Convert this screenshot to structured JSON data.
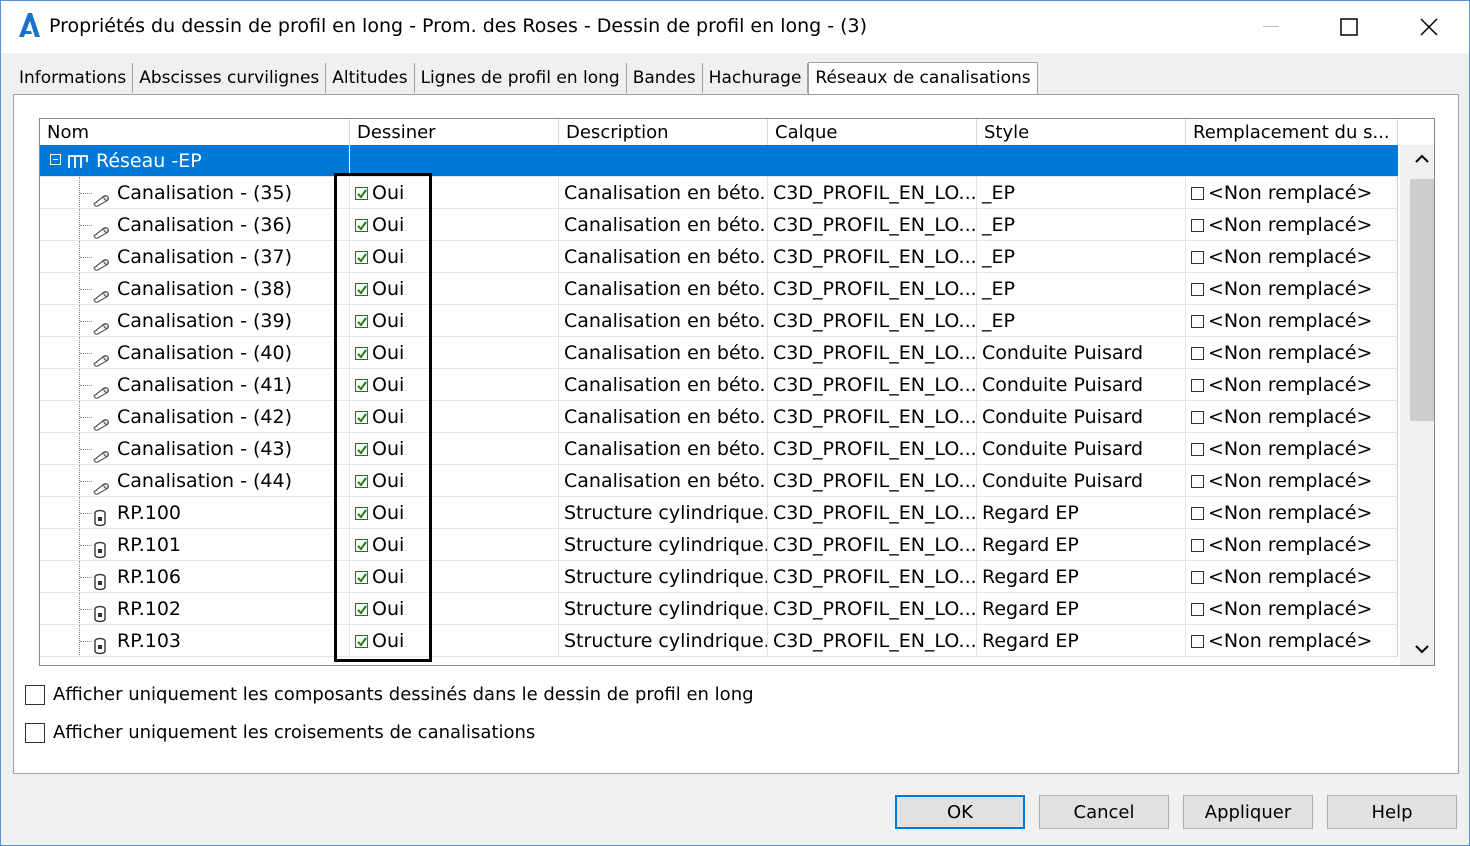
{
  "window": {
    "title": "Propriétés du dessin de profil en long - Prom. des Roses - Dessin de profil en long - (3)"
  },
  "tabs": [
    {
      "label": "Informations"
    },
    {
      "label": "Abscisses curvilignes"
    },
    {
      "label": "Altitudes"
    },
    {
      "label": "Lignes de profil en long"
    },
    {
      "label": "Bandes"
    },
    {
      "label": "Hachurage"
    },
    {
      "label": "Réseaux de canalisations",
      "active": true
    }
  ],
  "grid": {
    "columns": [
      "Nom",
      "Dessiner",
      "Description",
      "Calque",
      "Style",
      "Remplacement du s..."
    ],
    "network": {
      "label": "Réseau -EP"
    },
    "rows": [
      {
        "nom": "Canalisation - (35)",
        "icon": "pipe-icon",
        "dessiner": "Oui",
        "description": "Canalisation en béto...",
        "calque": "C3D_PROFIL_EN_LO...",
        "style": "_EP",
        "remplacement": "<Non remplacé>"
      },
      {
        "nom": "Canalisation - (36)",
        "icon": "pipe-icon",
        "dessiner": "Oui",
        "description": "Canalisation en béto...",
        "calque": "C3D_PROFIL_EN_LO...",
        "style": "_EP",
        "remplacement": "<Non remplacé>"
      },
      {
        "nom": "Canalisation - (37)",
        "icon": "pipe-icon",
        "dessiner": "Oui",
        "description": "Canalisation en béto...",
        "calque": "C3D_PROFIL_EN_LO...",
        "style": "_EP",
        "remplacement": "<Non remplacé>"
      },
      {
        "nom": "Canalisation - (38)",
        "icon": "pipe-icon",
        "dessiner": "Oui",
        "description": "Canalisation en béto...",
        "calque": "C3D_PROFIL_EN_LO...",
        "style": "_EP",
        "remplacement": "<Non remplacé>"
      },
      {
        "nom": "Canalisation - (39)",
        "icon": "pipe-icon",
        "dessiner": "Oui",
        "description": "Canalisation en béto...",
        "calque": "C3D_PROFIL_EN_LO...",
        "style": "_EP",
        "remplacement": "<Non remplacé>"
      },
      {
        "nom": "Canalisation - (40)",
        "icon": "pipe-icon",
        "dessiner": "Oui",
        "description": "Canalisation en béto...",
        "calque": "C3D_PROFIL_EN_LO...",
        "style": "Conduite Puisard",
        "remplacement": "<Non remplacé>"
      },
      {
        "nom": "Canalisation - (41)",
        "icon": "pipe-icon",
        "dessiner": "Oui",
        "description": "Canalisation en béto...",
        "calque": "C3D_PROFIL_EN_LO...",
        "style": "Conduite Puisard",
        "remplacement": "<Non remplacé>"
      },
      {
        "nom": "Canalisation - (42)",
        "icon": "pipe-icon",
        "dessiner": "Oui",
        "description": "Canalisation en béto...",
        "calque": "C3D_PROFIL_EN_LO...",
        "style": "Conduite Puisard",
        "remplacement": "<Non remplacé>"
      },
      {
        "nom": "Canalisation - (43)",
        "icon": "pipe-icon",
        "dessiner": "Oui",
        "description": "Canalisation en béto...",
        "calque": "C3D_PROFIL_EN_LO...",
        "style": "Conduite Puisard",
        "remplacement": "<Non remplacé>"
      },
      {
        "nom": "Canalisation - (44)",
        "icon": "pipe-icon",
        "dessiner": "Oui",
        "description": "Canalisation en béto...",
        "calque": "C3D_PROFIL_EN_LO...",
        "style": "Conduite Puisard",
        "remplacement": "<Non remplacé>"
      },
      {
        "nom": "RP.100",
        "icon": "structure-icon",
        "dessiner": "Oui",
        "description": "Structure cylindrique...",
        "calque": "C3D_PROFIL_EN_LO...",
        "style": "Regard EP",
        "remplacement": "<Non remplacé>"
      },
      {
        "nom": "RP.101",
        "icon": "structure-icon",
        "dessiner": "Oui",
        "description": "Structure cylindrique...",
        "calque": "C3D_PROFIL_EN_LO...",
        "style": "Regard EP",
        "remplacement": "<Non remplacé>"
      },
      {
        "nom": "RP.106",
        "icon": "structure-icon",
        "dessiner": "Oui",
        "description": "Structure cylindrique...",
        "calque": "C3D_PROFIL_EN_LO...",
        "style": "Regard EP",
        "remplacement": "<Non remplacé>"
      },
      {
        "nom": "RP.102",
        "icon": "structure-icon",
        "dessiner": "Oui",
        "description": "Structure cylindrique...",
        "calque": "C3D_PROFIL_EN_LO...",
        "style": "Regard EP",
        "remplacement": "<Non remplacé>"
      },
      {
        "nom": "RP.103",
        "icon": "structure-icon",
        "dessiner": "Oui",
        "description": "Structure cylindrique...",
        "calque": "C3D_PROFIL_EN_LO...",
        "style": "Regard EP",
        "remplacement": "<Non remplacé>"
      }
    ]
  },
  "options": {
    "only_drawn": "Afficher uniquement les composants dessinés dans le dessin de profil en long",
    "only_crossings": "Afficher uniquement les croisements de canalisations"
  },
  "buttons": {
    "ok": "OK",
    "cancel": "Cancel",
    "apply": "Appliquer",
    "help": "Help"
  },
  "colors": {
    "selection": "#0078d7",
    "checkbox_check": "#1f7a1f"
  }
}
